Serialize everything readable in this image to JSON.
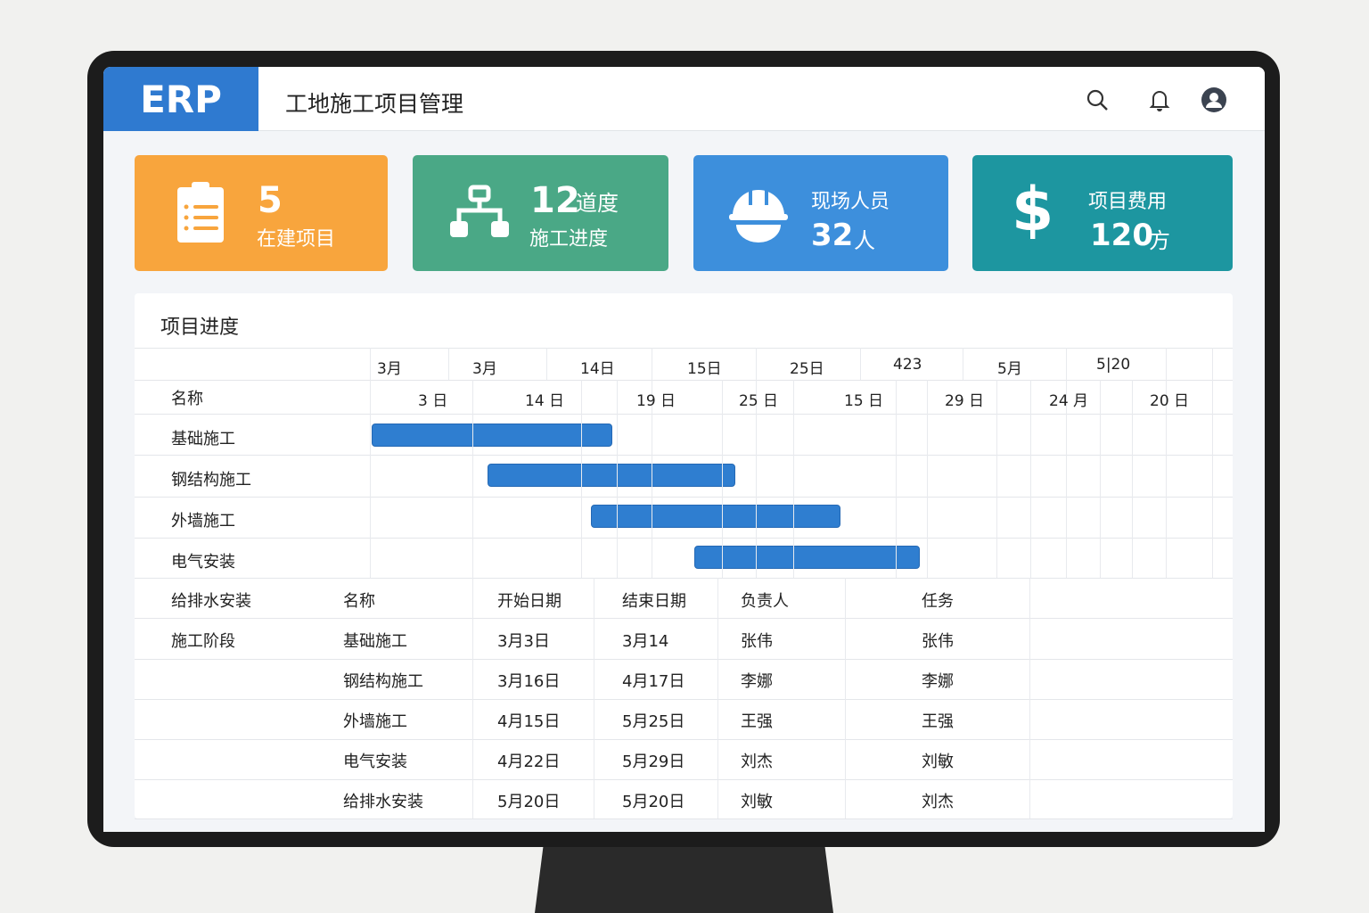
{
  "header": {
    "logo": "ERP",
    "title": "工地施工项目管理",
    "icons": [
      "search-icon",
      "bell-icon",
      "user-avatar-icon"
    ]
  },
  "cards": [
    {
      "value": "5",
      "label": "在建项目",
      "icon": "clipboard-icon",
      "color": "#f8a53d"
    },
    {
      "value": "12",
      "unit": "道度",
      "label": "施工进度",
      "icon": "hierarchy-icon",
      "color": "#4aa886"
    },
    {
      "label": "现场人员",
      "value": "32",
      "unit": "人",
      "icon": "hard-hat-icon",
      "color": "#3d8fdc"
    },
    {
      "label": "项目费用",
      "value": "120",
      "unit": "方",
      "icon": "dollar-icon",
      "color": "#1d96a0"
    }
  ],
  "gantt": {
    "title": "项目进度",
    "name_header": "名称",
    "top_ticks": [
      "3月",
      "3月",
      "14日",
      "15日",
      "25日",
      "423",
      "5月",
      "5|20"
    ],
    "bottom_ticks": [
      "3 日",
      "14 日",
      "19 日",
      "25 日",
      "15 日",
      "29 日",
      "24 月",
      "20 日"
    ],
    "tasks": [
      "基础施工",
      "钢结构施工",
      "外墙施工",
      "电气安装"
    ]
  },
  "table": {
    "headers": [
      "给排水安装",
      "名称",
      "开始日期",
      "结束日期",
      "负责人",
      "任务"
    ],
    "group_label": "施工阶段",
    "rows": [
      [
        "基础施工",
        "3月3日",
        "3月14",
        "张伟",
        "张伟"
      ],
      [
        "钢结构施工",
        "3月16日",
        "4月17日",
        "李娜",
        "李娜"
      ],
      [
        "外墙施工",
        "4月15日",
        "5月25日",
        "王强",
        "王强"
      ],
      [
        "电气安装",
        "4月22日",
        "5月29日",
        "刘杰",
        "刘敏"
      ],
      [
        "给排水安装",
        "5月20日",
        "5月20日",
        "刘敏",
        "刘杰"
      ]
    ]
  }
}
